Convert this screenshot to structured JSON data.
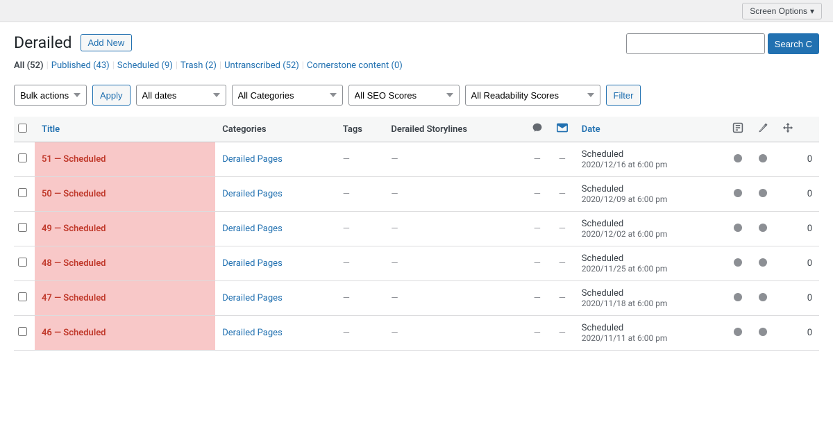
{
  "topbar": {
    "screen_options_label": "Screen Options"
  },
  "page": {
    "title": "Derailed",
    "add_new_label": "Add New"
  },
  "filter_links": [
    {
      "label": "All",
      "count": "52",
      "key": "all",
      "current": true
    },
    {
      "label": "Published",
      "count": "43",
      "key": "published"
    },
    {
      "label": "Scheduled",
      "count": "9",
      "key": "scheduled"
    },
    {
      "label": "Trash",
      "count": "2",
      "key": "trash"
    },
    {
      "label": "Untranscribed",
      "count": "52",
      "key": "untranscribed"
    },
    {
      "label": "Cornerstone content",
      "count": "0",
      "key": "cornerstone"
    }
  ],
  "search": {
    "placeholder": "",
    "button_label": "Search C"
  },
  "toolbar": {
    "bulk_actions_label": "Bulk actions",
    "apply_label": "Apply",
    "all_dates_label": "All dates",
    "all_categories_label": "All Categories",
    "all_seo_label": "All SEO Scores",
    "all_readability_label": "All Readability Scores",
    "filter_label": "Filter"
  },
  "table": {
    "columns": [
      {
        "key": "title",
        "label": "Title",
        "sortable": true
      },
      {
        "key": "categories",
        "label": "Categories"
      },
      {
        "key": "tags",
        "label": "Tags"
      },
      {
        "key": "storylines",
        "label": "Derailed Storylines"
      },
      {
        "key": "comments",
        "label": ""
      },
      {
        "key": "chat",
        "label": ""
      },
      {
        "key": "date",
        "label": "Date",
        "sortable": true
      },
      {
        "key": "seo",
        "label": ""
      },
      {
        "key": "edit",
        "label": ""
      },
      {
        "key": "move",
        "label": ""
      },
      {
        "key": "count",
        "label": ""
      }
    ],
    "rows": [
      {
        "id": 1,
        "title": "51 — Scheduled",
        "category": "Derailed Pages",
        "tags": "—",
        "storylines": "—",
        "comments": "—",
        "chat": "—",
        "date_status": "Scheduled",
        "date_value": "2020/12/16 at 6:00 pm",
        "count": "0"
      },
      {
        "id": 2,
        "title": "50 — Scheduled",
        "category": "Derailed Pages",
        "tags": "—",
        "storylines": "—",
        "comments": "—",
        "chat": "—",
        "date_status": "Scheduled",
        "date_value": "2020/12/09 at 6:00 pm",
        "count": "0"
      },
      {
        "id": 3,
        "title": "49 — Scheduled",
        "category": "Derailed Pages",
        "tags": "—",
        "storylines": "—",
        "comments": "—",
        "chat": "—",
        "date_status": "Scheduled",
        "date_value": "2020/12/02 at 6:00 pm",
        "count": "0"
      },
      {
        "id": 4,
        "title": "48 — Scheduled",
        "category": "Derailed Pages",
        "tags": "—",
        "storylines": "—",
        "comments": "—",
        "chat": "—",
        "date_status": "Scheduled",
        "date_value": "2020/11/25 at 6:00 pm",
        "count": "0"
      },
      {
        "id": 5,
        "title": "47 — Scheduled",
        "category": "Derailed Pages",
        "tags": "—",
        "storylines": "—",
        "comments": "—",
        "chat": "—",
        "date_status": "Scheduled",
        "date_value": "2020/11/18 at 6:00 pm",
        "count": "0"
      },
      {
        "id": 6,
        "title": "46 — Scheduled",
        "category": "Derailed Pages",
        "tags": "—",
        "storylines": "—",
        "comments": "—",
        "chat": "—",
        "date_status": "Scheduled",
        "date_value": "2020/11/11 at 6:00 pm",
        "count": "0"
      }
    ]
  }
}
